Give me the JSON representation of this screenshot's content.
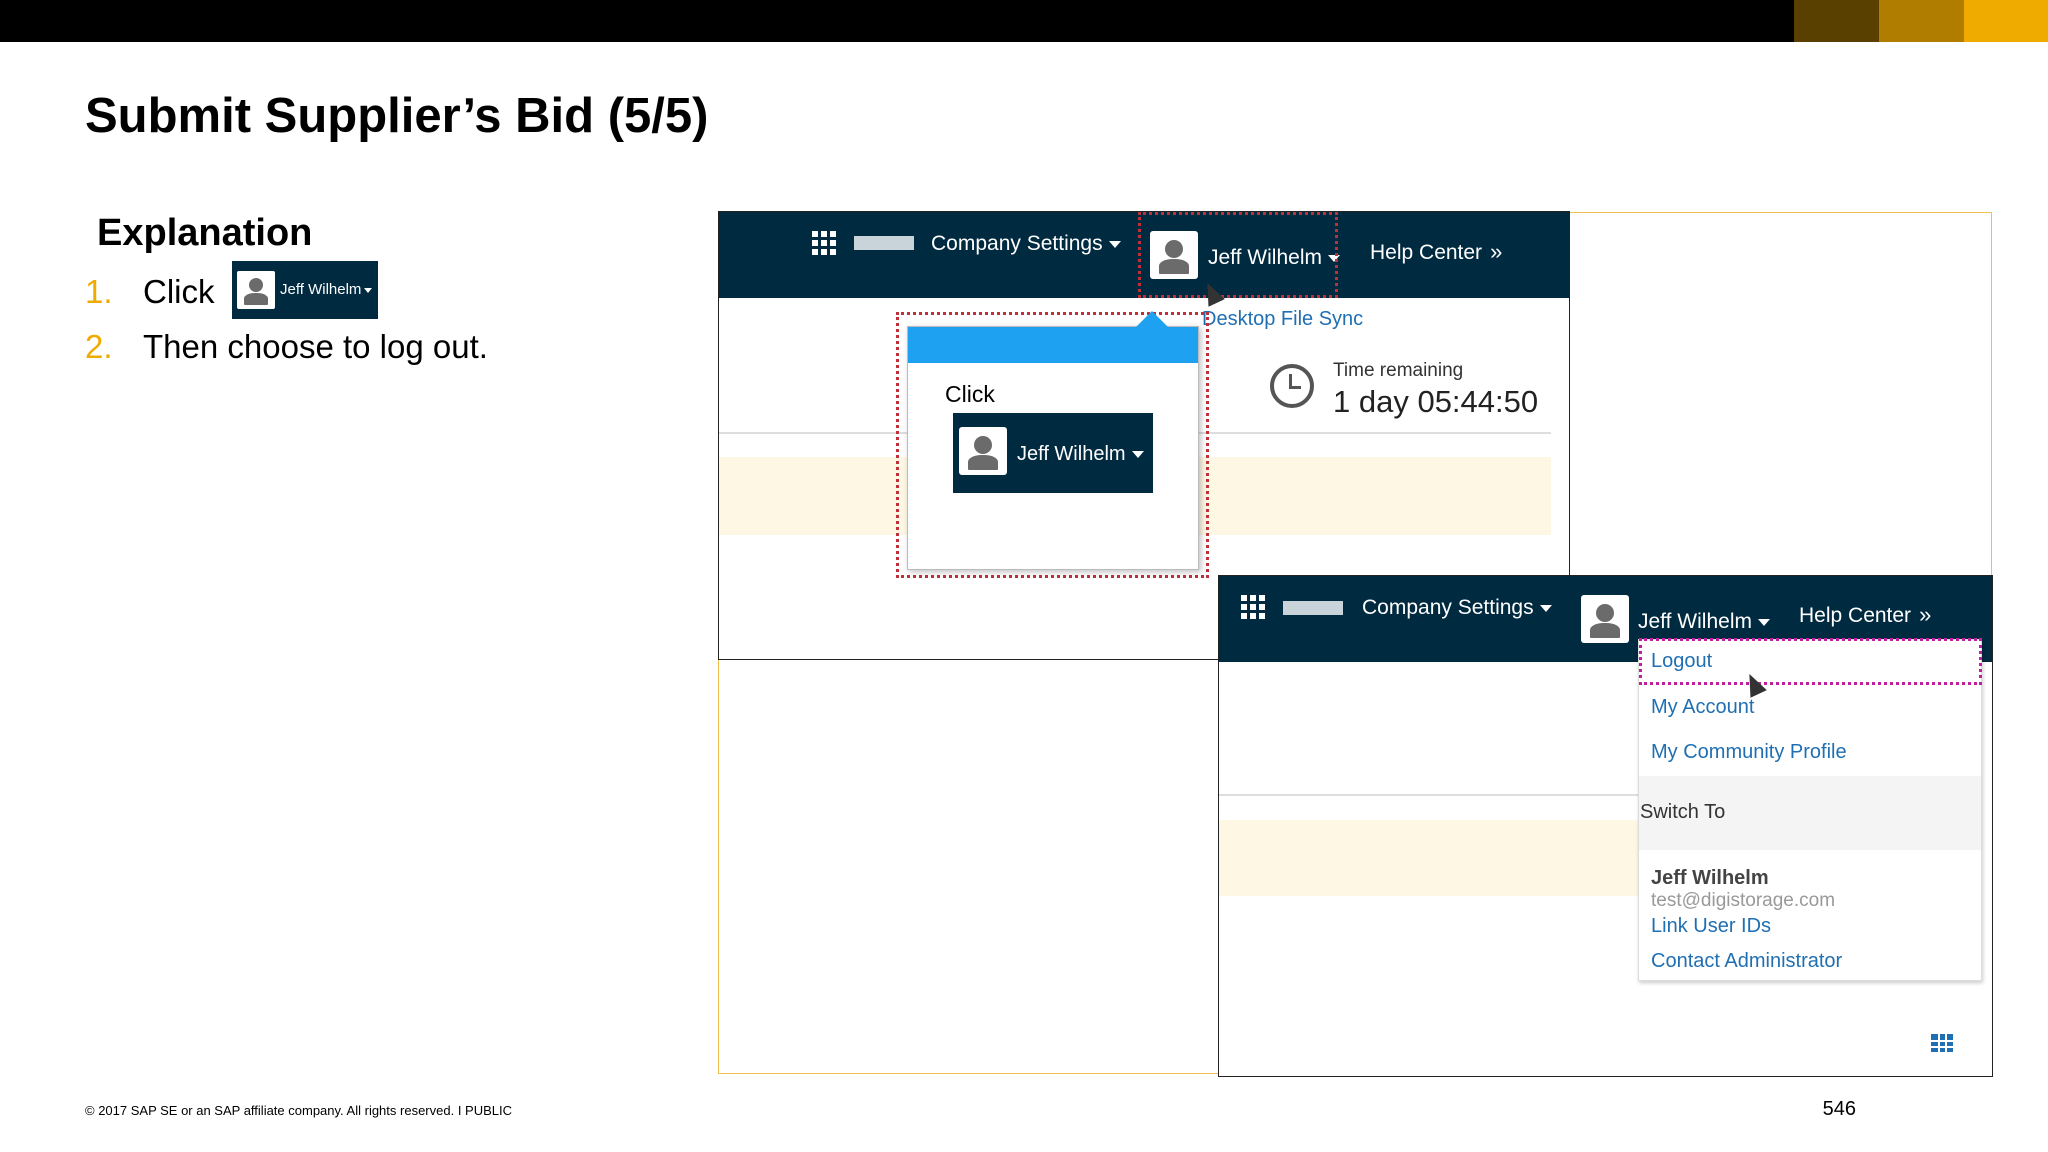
{
  "slide": {
    "title": "Submit Supplier’s Bid (5/5)",
    "explanation_heading": "Explanation",
    "steps": [
      {
        "num": "1.",
        "text": "Click"
      },
      {
        "num": "2.",
        "text": "Then choose to log out."
      }
    ],
    "inline_button_label": "Jeff Wilhelm",
    "footer": "© 2017 SAP SE or an SAP affiliate company. All rights reserved.  I   PUBLIC",
    "page_number": "546"
  },
  "screenshot1": {
    "company_settings": "Company Settings",
    "user_name": "Jeff Wilhelm",
    "help_center": "Help Center",
    "desktop_file_sync": "Desktop File Sync",
    "callout_click": "Click",
    "callout_user": "Jeff Wilhelm",
    "time_remaining_label": "Time remaining",
    "time_remaining_value": "1 day 05:44:50"
  },
  "screenshot2": {
    "company_settings": "Company Settings",
    "user_name": "Jeff Wilhelm",
    "help_center": "Help Center",
    "menu": {
      "logout": "Logout",
      "my_account": "My Account",
      "my_community_profile": "My Community Profile",
      "switch_to": "Switch To",
      "account_name": "Jeff Wilhelm",
      "account_email": "test@digistorage.com",
      "link_user_ids": "Link User IDs",
      "contact_administrator": "Contact Administrator"
    }
  },
  "colors": {
    "accent": "#f0ab00",
    "nav": "#002a40",
    "link": "#1f6fb2",
    "callout_blue": "#1ea1f1"
  }
}
